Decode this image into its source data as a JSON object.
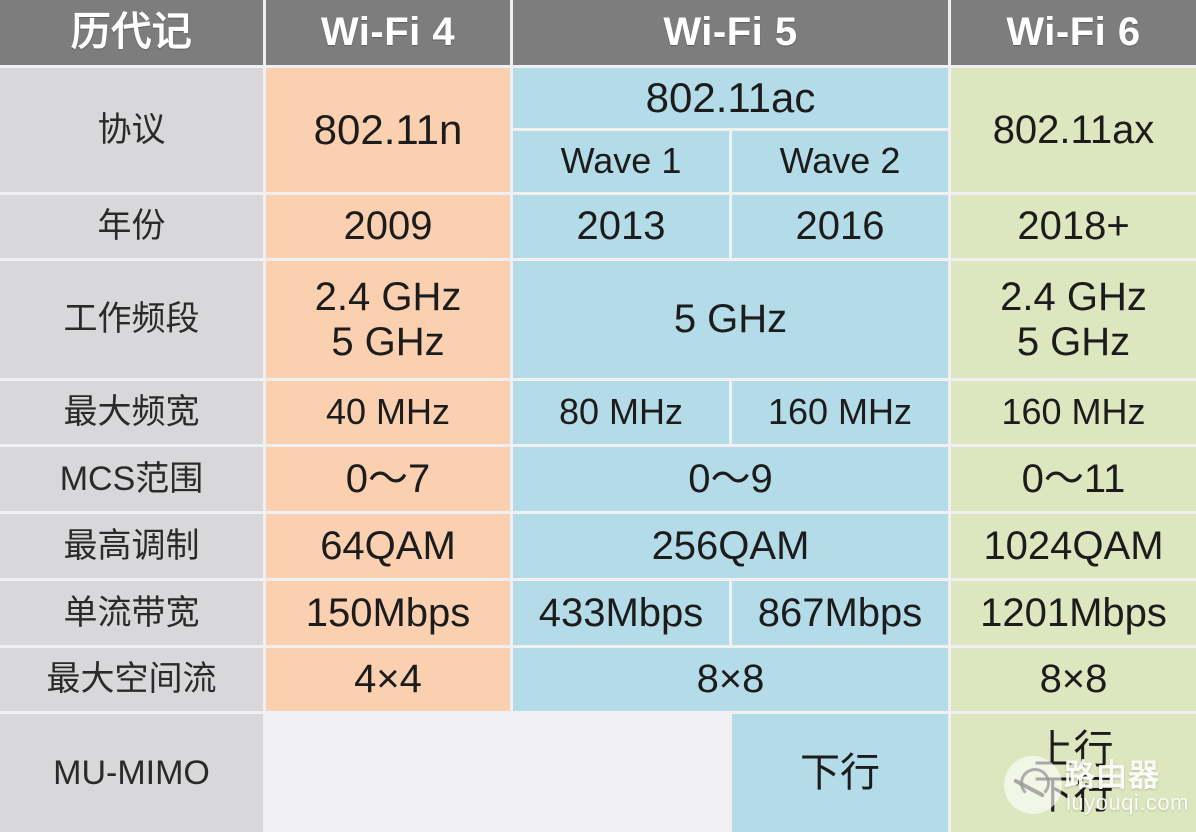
{
  "table": {
    "headers": {
      "row_label": "历代记",
      "wifi4": "Wi-Fi 4",
      "wifi5": "Wi-Fi 5",
      "wifi6": "Wi-Fi 6"
    },
    "rows": [
      {
        "label": "协议",
        "wifi4": "802.11n",
        "wifi5_merged": "802.11ac",
        "wifi5_wave1": "Wave 1",
        "wifi5_wave2": "Wave 2",
        "wifi6": "802.11ax"
      },
      {
        "label": "年份",
        "wifi4": "2009",
        "wifi5_wave1": "2013",
        "wifi5_wave2": "2016",
        "wifi6": "2018+"
      },
      {
        "label": "工作频段",
        "wifi4": "2.4 GHz\n5 GHz",
        "wifi5_merged": "5 GHz",
        "wifi6": "2.4 GHz\n5 GHz"
      },
      {
        "label": "最大频宽",
        "wifi4": "40 MHz",
        "wifi5_wave1": "80 MHz",
        "wifi5_wave2": "160 MHz",
        "wifi6": "160 MHz"
      },
      {
        "label": "MCS范围",
        "wifi4": "0～7",
        "wifi5_merged": "0～9",
        "wifi6": "0～11"
      },
      {
        "label": "最高调制",
        "wifi4": "64QAM",
        "wifi5_merged": "256QAM",
        "wifi6": "1024QAM"
      },
      {
        "label": "单流带宽",
        "wifi4": "150Mbps",
        "wifi5_wave1": "433Mbps",
        "wifi5_wave2": "867Mbps",
        "wifi6": "1201Mbps"
      },
      {
        "label": "最大空间流",
        "wifi4": "4×4",
        "wifi5_merged": "8×8",
        "wifi6": "8×8"
      },
      {
        "label": "MU-MIMO",
        "wifi4": "",
        "wifi5_wave1": "",
        "wifi5_wave2": "下行",
        "wifi6": "上行\n下行"
      }
    ]
  },
  "watermark": {
    "cn": "路由器",
    "en": "luyouqi.com"
  },
  "colors": {
    "header_bg": "#7d7d7d",
    "row_label_bg": "#d8d8da",
    "wifi4_bg": "#fad0b0",
    "wifi5_bg": "#b4dce8",
    "wifi6_bg": "#dde6be",
    "page_bg": "#f0eff1"
  }
}
